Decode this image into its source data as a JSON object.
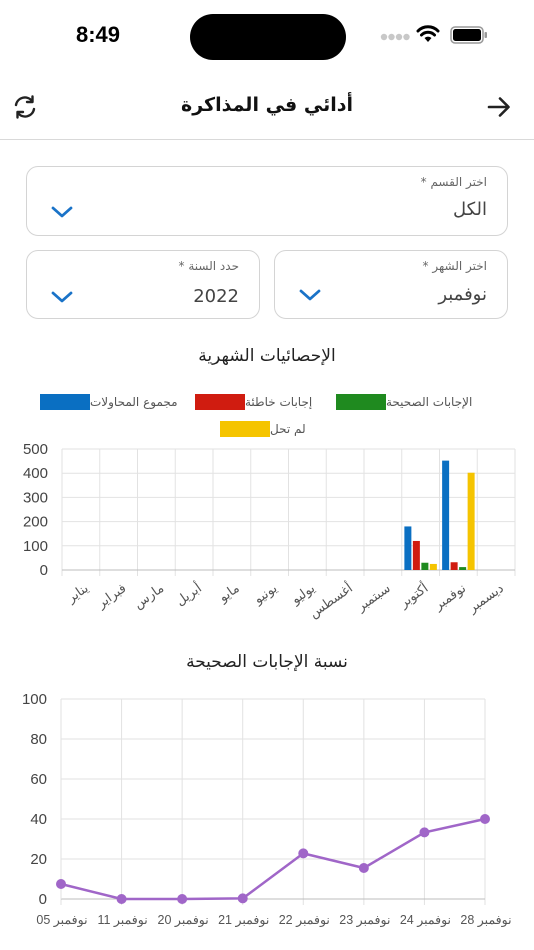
{
  "status": {
    "time": "8:49"
  },
  "header": {
    "title": "أدائي في المذاكرة"
  },
  "filters": {
    "section": {
      "label": "اختر القسم *",
      "value": "الكل"
    },
    "month": {
      "label": "اختر الشهر *",
      "value": "نوفمبر"
    },
    "year": {
      "label": "حدد السنة *",
      "value": "2022"
    }
  },
  "colors": {
    "accent": "#1a73c8",
    "blue": "#0a6fc2",
    "red": "#d01c10",
    "green": "#1f8a1f",
    "yellow": "#f5c400",
    "purple": "#a066c8"
  },
  "monthly_chart": {
    "title": "الإحصائيات الشهرية",
    "legend": [
      "مجموع المحاولات",
      "إجابات خاطئة",
      "الإجابات الصحيحة",
      "لم تحل"
    ]
  },
  "ratio_chart": {
    "title": "نسبة الإجابات الصحيحة"
  },
  "chart_data": [
    {
      "type": "bar",
      "title": "الإحصائيات الشهرية",
      "categories": [
        "يناير",
        "فبراير",
        "مارس",
        "أبريل",
        "مايو",
        "يونيو",
        "يوليو",
        "أغسطس",
        "سبتمبر",
        "أكتوبر",
        "نوفمبر",
        "ديسمبر"
      ],
      "series": [
        {
          "name": "مجموع المحاولات",
          "values": [
            0,
            0,
            0,
            0,
            0,
            0,
            0,
            0,
            0,
            180,
            452,
            0
          ]
        },
        {
          "name": "إجابات خاطئة",
          "values": [
            0,
            0,
            0,
            0,
            0,
            0,
            0,
            0,
            0,
            120,
            32,
            0
          ]
        },
        {
          "name": "الإجابات الصحيحة",
          "values": [
            0,
            0,
            0,
            0,
            0,
            0,
            0,
            0,
            0,
            30,
            12,
            0
          ]
        },
        {
          "name": "لم تحل",
          "values": [
            0,
            0,
            0,
            0,
            0,
            0,
            0,
            0,
            0,
            25,
            402,
            0
          ]
        }
      ],
      "yticks": [
        0,
        100,
        200,
        300,
        400,
        500
      ],
      "ylim": [
        0,
        500
      ],
      "grid": true,
      "legend_position": "top"
    },
    {
      "type": "line",
      "title": "نسبة الإجابات الصحيحة",
      "x": [
        "نوفمبر 05",
        "نوفمبر 11",
        "نوفمبر 20",
        "نوفمبر 21",
        "نوفمبر 22",
        "نوفمبر 23",
        "نوفمبر 24",
        "نوفمبر 28"
      ],
      "series": [
        {
          "values": [
            7.5,
            0,
            0,
            0.3,
            22.8,
            15.5,
            33.3,
            40
          ]
        }
      ],
      "yticks": [
        0,
        20,
        40,
        60,
        80,
        100
      ],
      "ylim": [
        0,
        100
      ],
      "grid": true
    }
  ]
}
